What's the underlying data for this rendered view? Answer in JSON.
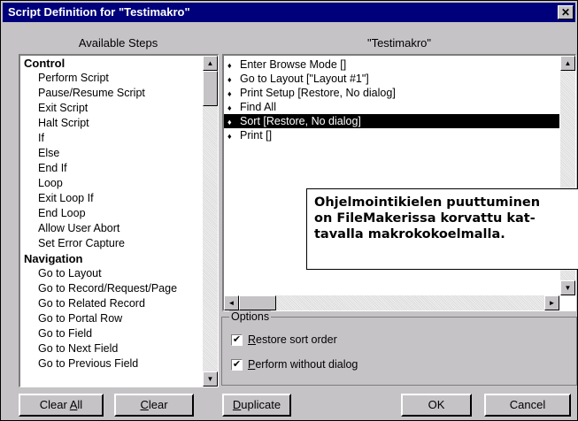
{
  "window": {
    "title": "Script Definition for \"Testimakro\"",
    "close_glyph": "✕"
  },
  "available_steps": {
    "header": "Available Steps",
    "groups": [
      {
        "category": "Control",
        "items": [
          "Perform Script",
          "Pause/Resume Script",
          "Exit Script",
          "Halt Script",
          "If",
          "Else",
          "End If",
          "Loop",
          "Exit Loop If",
          "End Loop",
          "Allow User Abort",
          "Set Error Capture"
        ]
      },
      {
        "category": "Navigation",
        "items": [
          "Go to Layout",
          "Go to Record/Request/Page",
          "Go to Related Record",
          "Go to Portal Row",
          "Go to Field",
          "Go to Next Field",
          "Go to Previous Field"
        ]
      }
    ]
  },
  "script": {
    "header": "\"Testimakro\"",
    "steps": [
      {
        "text": "Enter Browse Mode []",
        "selected": false
      },
      {
        "text": "Go to Layout [\"Layout #1\"]",
        "selected": false
      },
      {
        "text": "Print Setup [Restore, No dialog]",
        "selected": false
      },
      {
        "text": "Find All",
        "selected": false
      },
      {
        "text": "Sort [Restore, No dialog]",
        "selected": true
      },
      {
        "text": "Print []",
        "selected": false
      }
    ],
    "bullet_glyph": "♦"
  },
  "annotation": {
    "lines": [
      "Ohjelmointikielen puuttuminen",
      "on FileMakerissa korvattu kat-",
      "tavalla makrokokoelmalla."
    ]
  },
  "options": {
    "legend": "Options",
    "restore_sort_order": {
      "label": "Restore sort order",
      "checked": true
    },
    "perform_without_dialog": {
      "label": "Perform without dialog",
      "checked": true
    }
  },
  "buttons": {
    "clear_all": "Clear All",
    "clear": "Clear",
    "duplicate": "Duplicate",
    "ok": "OK",
    "cancel": "Cancel"
  },
  "colors": {
    "titlebar": "#00007b",
    "face": "#c6c3c6",
    "selection": "#000000"
  }
}
